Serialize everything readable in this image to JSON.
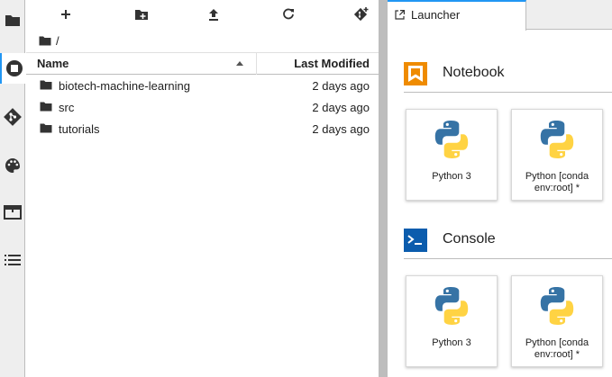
{
  "activity_bar": {
    "items": [
      {
        "name": "file-browser",
        "icon": "folder-icon"
      },
      {
        "name": "running-sessions",
        "icon": "stop-circle-icon",
        "active": true
      },
      {
        "name": "git",
        "icon": "git-icon"
      },
      {
        "name": "commands",
        "icon": "palette-icon"
      },
      {
        "name": "open-tabs",
        "icon": "tab-icon"
      },
      {
        "name": "table-of-contents",
        "icon": "list-icon"
      }
    ]
  },
  "filebrowser": {
    "toolbar": [
      "new-launcher-plus-icon",
      "new-folder-icon",
      "upload-icon",
      "refresh-icon",
      "git-clone-icon"
    ],
    "breadcrumb": {
      "path": "/"
    },
    "columns": {
      "name": "Name",
      "modified": "Last Modified"
    },
    "files": [
      {
        "name": "biotech-machine-learning",
        "modified": "2 days ago",
        "type": "folder"
      },
      {
        "name": "src",
        "modified": "2 days ago",
        "type": "folder"
      },
      {
        "name": "tutorials",
        "modified": "2 days ago",
        "type": "folder"
      }
    ]
  },
  "main": {
    "tab": {
      "label": "Launcher"
    },
    "sections": [
      {
        "title": "Notebook",
        "icon": "notebook-icon",
        "cards": [
          {
            "label": "Python 3"
          },
          {
            "label": "Python [conda env:root] *"
          }
        ]
      },
      {
        "title": "Console",
        "icon": "console-icon",
        "cards": [
          {
            "label": "Python 3"
          },
          {
            "label": "Python [conda env:root] *"
          }
        ]
      }
    ]
  },
  "colors": {
    "accent": "#2196f3",
    "icon_dark": "#333333",
    "notebook_orange": "#ef8b00",
    "console_blue": "#0b5cad",
    "python_blue": "#3673a5",
    "python_yellow": "#ffd343"
  }
}
